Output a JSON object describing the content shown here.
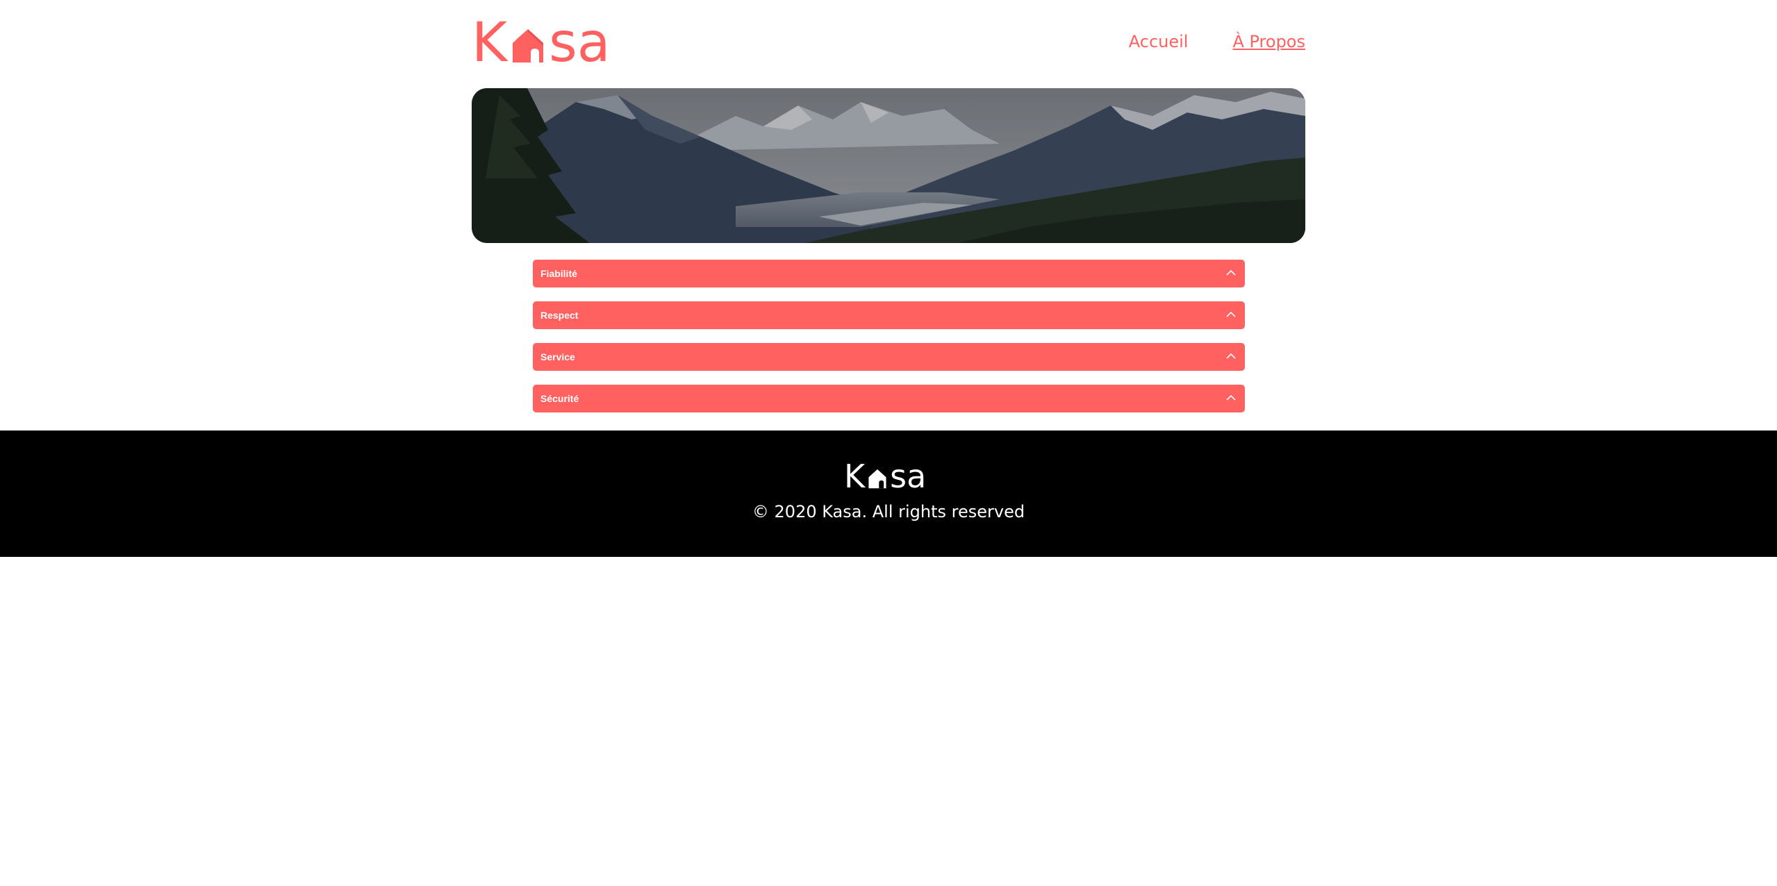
{
  "header": {
    "logo_letters": [
      "K",
      "s",
      "a"
    ],
    "nav": [
      {
        "label": "Accueil",
        "active": false
      },
      {
        "label": "À Propos",
        "active": true
      }
    ]
  },
  "banner": {
    "description": "mountain landscape banner"
  },
  "collapses": [
    {
      "title": "Fiabilité",
      "icon": "chevron-up-icon"
    },
    {
      "title": "Respect",
      "icon": "chevron-up-icon"
    },
    {
      "title": "Service",
      "icon": "chevron-up-icon"
    },
    {
      "title": "Sécurité",
      "icon": "chevron-up-icon"
    }
  ],
  "footer": {
    "logo_letters": [
      "K",
      "s",
      "a"
    ],
    "copyright": "© 2020 Kasa. All rights reserved"
  },
  "colors": {
    "accent": "#ff6060",
    "footer_bg": "#000000",
    "text_light": "#ffffff"
  }
}
